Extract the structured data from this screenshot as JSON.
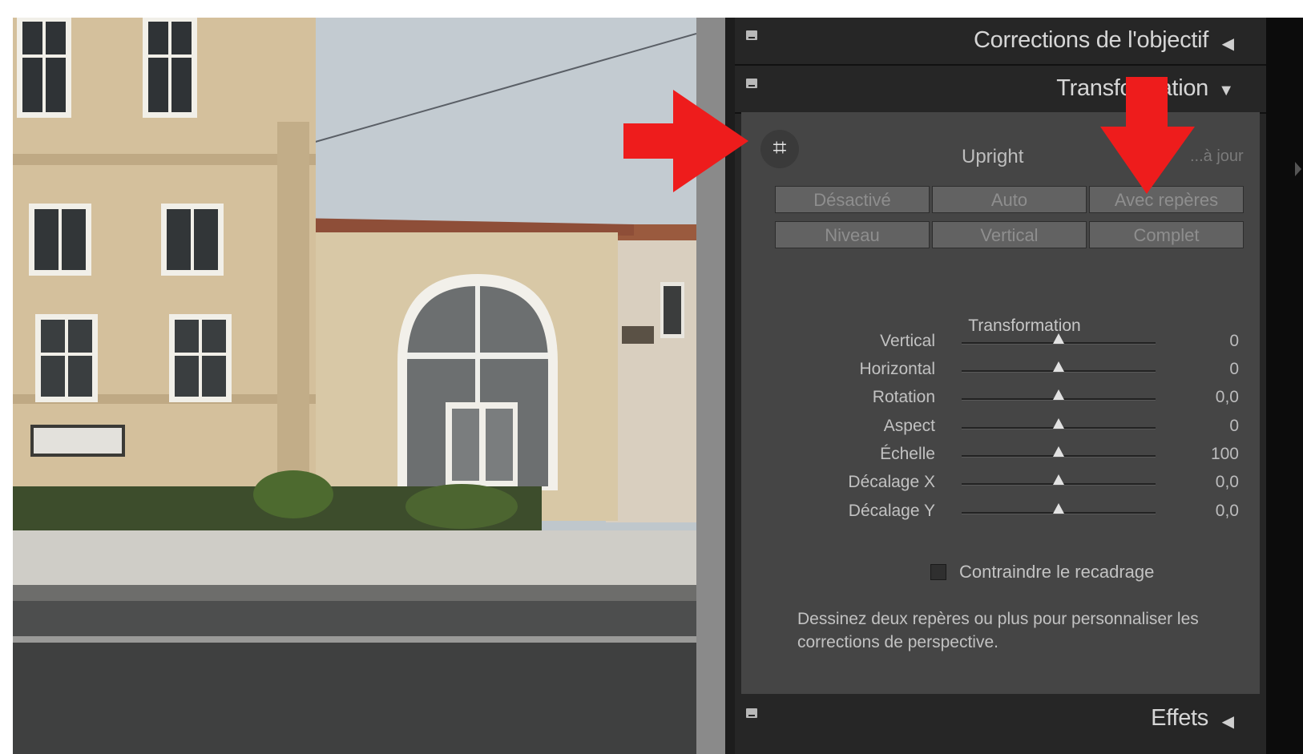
{
  "panel": {
    "sections": {
      "lens_corrections": "Corrections de l'objectif",
      "transform": "Transformation",
      "effects": "Effets"
    },
    "arrows": {
      "collapsed": "◀",
      "expanded": "▼"
    }
  },
  "upright": {
    "label": "Upright",
    "update_label": "...à jour",
    "buttons_row1": [
      "Désactivé",
      "Auto",
      "Avec repères"
    ],
    "buttons_row2": [
      "Niveau",
      "Vertical",
      "Complet"
    ]
  },
  "transformation": {
    "title": "Transformation",
    "sliders": [
      {
        "label": "Vertical",
        "value": "0",
        "fraction": 0.5
      },
      {
        "label": "Horizontal",
        "value": "0",
        "fraction": 0.5
      },
      {
        "label": "Rotation",
        "value": "0,0",
        "fraction": 0.5
      },
      {
        "label": "Aspect",
        "value": "0",
        "fraction": 0.5
      },
      {
        "label": "Échelle",
        "value": "100",
        "fraction": 0.5
      },
      {
        "label": "Décalage X",
        "value": "0,0",
        "fraction": 0.5
      },
      {
        "label": "Décalage Y",
        "value": "0,0",
        "fraction": 0.5
      }
    ],
    "constrain_crop": {
      "label": "Contraindre le recadrage",
      "checked": false
    },
    "help_text": "Dessinez deux repères ou plus pour personnaliser les corrections de perspective."
  },
  "colors": {
    "annotation_red": "#ee1c1c",
    "panel_bg": "#262626",
    "panel_body": "#454545"
  }
}
